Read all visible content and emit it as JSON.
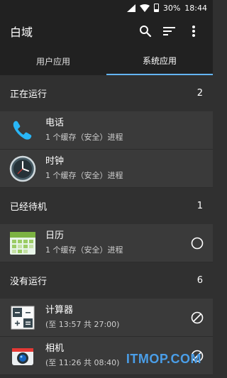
{
  "status": {
    "battery": "30%",
    "time": "18:44"
  },
  "appbar": {
    "title": "白域"
  },
  "tabs": [
    {
      "label": "用户应用",
      "active": false
    },
    {
      "label": "系统应用",
      "active": true
    }
  ],
  "sections": {
    "running": {
      "title": "正在运行",
      "count": "2"
    },
    "standby": {
      "title": "已经待机",
      "count": "1"
    },
    "stopped": {
      "title": "没有运行",
      "count": "6"
    }
  },
  "apps": {
    "phone": {
      "name": "电话",
      "sub": "1 个缓存（安全）进程",
      "icon": "phone-icon"
    },
    "clock": {
      "name": "时钟",
      "sub": "1 个缓存（安全）进程",
      "icon": "clock-icon"
    },
    "calendar": {
      "name": "日历",
      "sub": "1 个缓存（安全）进程",
      "icon": "calendar-icon"
    },
    "calculator": {
      "name": "计算器",
      "sub": "(至 13:57 共 27:00)",
      "icon": "calculator-icon"
    },
    "camera": {
      "name": "相机",
      "sub": "(至 11:26 共 08:40)",
      "icon": "camera-icon"
    }
  },
  "watermark": "ITMOP.COM",
  "colors": {
    "accent": "#64b5f6",
    "appbar": "#212121",
    "row": "#3a3a3a",
    "bg": "#303030"
  }
}
